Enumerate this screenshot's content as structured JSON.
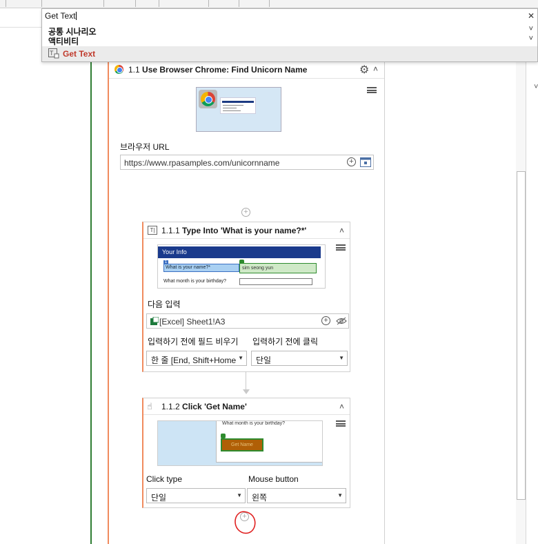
{
  "search": {
    "value": "Get Text",
    "clear_icon": "close-icon",
    "categories": [
      {
        "label": "공통 시나리오"
      },
      {
        "label": "액티비티"
      }
    ],
    "result": {
      "label": "Get Text",
      "icon": "get-text-icon",
      "color": "#c0392b"
    }
  },
  "use_browser": {
    "number": "1.1",
    "title": "Use Browser Chrome: Find Unicorn Name",
    "url_label": "브라우저 URL",
    "url_value": "https://www.rpasamples.com/unicornname"
  },
  "type_into": {
    "number": "1.1.1",
    "title": "Type Into 'What is your name?*'",
    "preview": {
      "header": "Your Info",
      "question": "What is your name?*",
      "answer": "sim seong yun",
      "question2": "What month is your birthday?"
    },
    "next_input_label": "다음 입력",
    "next_input_value": "[Excel] Sheet1!A3",
    "clear_field_label": "입력하기 전에 필드 비우기",
    "click_before_label": "입력하기 전에 클릭",
    "clear_field_value": "한 줄 [End, Shift+Home",
    "click_before_value": "단일"
  },
  "click": {
    "number": "1.1.2",
    "title": "Click 'Get Name'",
    "preview": {
      "text": "What month is your birthday?",
      "button": "Get Name"
    },
    "click_type_label": "Click type",
    "mouse_button_label": "Mouse button",
    "click_type_value": "단일",
    "mouse_button_value": "왼쪽"
  },
  "colors": {
    "accent_orange": "#f08a5d",
    "sequence_green": "#2e7d32",
    "annotation_red": "#e02020"
  }
}
